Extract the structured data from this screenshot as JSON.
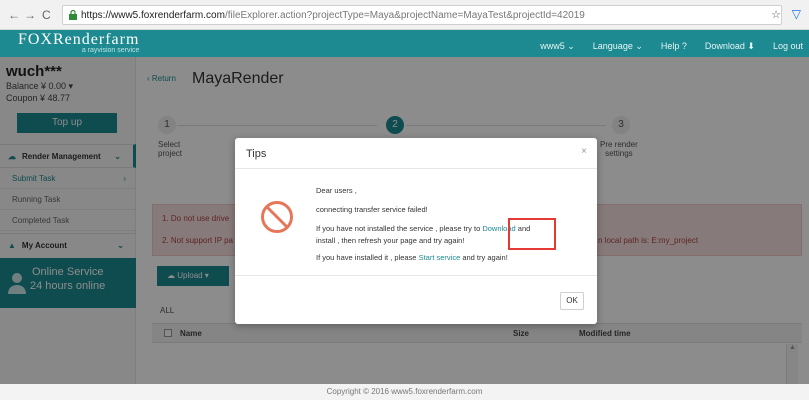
{
  "browser": {
    "back": "←",
    "forward": "→",
    "reload": "C",
    "url_host": "https://www5.foxrenderfarm.com",
    "url_path": "/fileExplorer.action?projectType=Maya&projectName=MayaTest&projectId=42019"
  },
  "brand": {
    "name": "FOXRenderfarm",
    "tagline": "a rayvision service"
  },
  "topnav": [
    "www5 ⌄",
    "Language ⌄",
    "Help ?",
    "Download ⬇",
    "Log out"
  ],
  "sidebar": {
    "username": "wuch***",
    "balance": "Balance   ¥ 0.00 ▾",
    "coupon": "Coupon   ¥ 48.77",
    "topup": "Top up",
    "render_management": "Render Management",
    "items": [
      "Submit Task",
      "Running Task",
      "Completed Task"
    ],
    "my_account": "My Account",
    "online1": "Online Service",
    "online2": "24 hours online"
  },
  "main": {
    "back": "‹ Return",
    "title": "MayaRender",
    "steps": [
      {
        "num": "1",
        "label1": "Select",
        "label2": "project"
      },
      {
        "num": "2",
        "label1": "",
        "label2": ""
      },
      {
        "num": "3",
        "label1": "Pre render",
        "label2": "settings"
      }
    ],
    "alert1": "1. Do not use drive",
    "alert2": "2. Not support IP pa",
    "alert_right": "n local path is: E:my_project",
    "upload": "Upload ▾",
    "all": "ALL",
    "col_name": "Name",
    "col_size": "Size",
    "col_modified": "Modified time"
  },
  "modal": {
    "title": "Tips",
    "close": "×",
    "line1": "Dear users ,",
    "line2": "connecting transfer service failed!",
    "line3a": "If you have not installed the service ,  please try to ",
    "line3link": "Download",
    "line3b": " and",
    "line4": "install ,  then refresh your page and try again!",
    "line5a": "If you have installed it ,  please ",
    "line5link": "Start service",
    "line5b": " and try again!",
    "ok": "OK"
  },
  "footer": "Copyright © 2016 www5.foxrenderfarm.com",
  "colors": {
    "teal": "#1c8a90",
    "alert_bg": "#f6dede",
    "highlight": "#e53935"
  }
}
